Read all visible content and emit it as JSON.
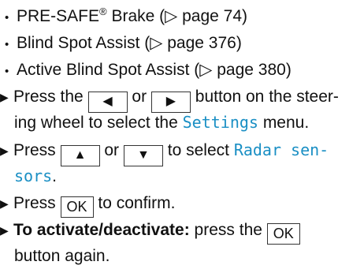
{
  "bullets": [
    {
      "name": "PRE-SAFE",
      "sup": "®",
      "rest": " Brake (▷ page 74)"
    },
    {
      "text": "Blind Spot Assist (▷ page 376)"
    },
    {
      "text": "Active Blind Spot Assist (▷ page 380)"
    }
  ],
  "steps": {
    "s1": {
      "press": "Press the",
      "btn_left": "◀",
      "or": "or",
      "btn_right": "▶",
      "after": "button on the steer-",
      "line2_pre": "ing wheel to select the",
      "menu": "Settings",
      "line2_post": "menu."
    },
    "s2": {
      "press": "Press",
      "btn_up": "▲",
      "or": "or",
      "btn_down": "▼",
      "after": "to select",
      "menu_a": "Radar sen-",
      "menu_b": "sors",
      "period": "."
    },
    "s3": {
      "press": "Press",
      "btn_ok": "OK",
      "after": "to confirm."
    },
    "s4": {
      "bold": "To activate/deactivate:",
      "after": "press the",
      "btn_ok": "OK",
      "line2": "button again."
    }
  },
  "glyphs": {
    "bullet": "•",
    "arrow": "▶"
  },
  "colors": {
    "menu_text": "#1a8fc4"
  }
}
